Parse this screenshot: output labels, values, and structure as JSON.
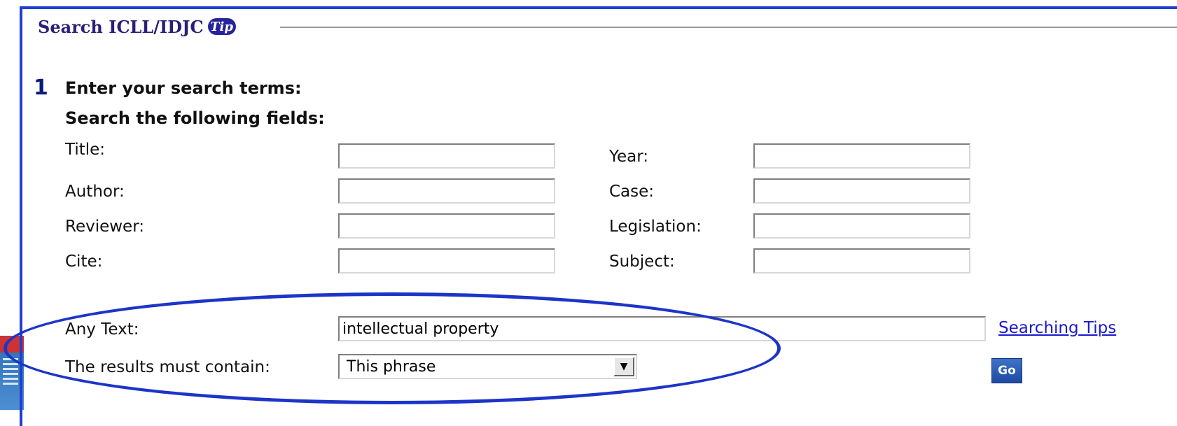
{
  "fieldset": {
    "legend": "Search ICLL/IDJC",
    "tip_icon_text": "Tip"
  },
  "step": {
    "number": "1",
    "heading": "Enter your search terms:",
    "subheading": "Search the following fields:"
  },
  "fields_left": [
    {
      "label": "Title:",
      "value": ""
    },
    {
      "label": "Author:",
      "value": ""
    },
    {
      "label": "Reviewer:",
      "value": ""
    },
    {
      "label": "Cite:",
      "value": ""
    }
  ],
  "fields_right": [
    {
      "label": "Year:",
      "value": ""
    },
    {
      "label": "Case:",
      "value": ""
    },
    {
      "label": "Legislation:",
      "value": ""
    },
    {
      "label": "Subject:",
      "value": ""
    }
  ],
  "any_text": {
    "label": "Any Text:",
    "value": "intellectual property"
  },
  "results": {
    "label": "The results must contain:",
    "selected": "This phrase"
  },
  "links": {
    "searching_tips": "Searching Tips"
  },
  "buttons": {
    "go": "Go"
  },
  "colors": {
    "frame": "#1f3fcf",
    "legend": "#2a1f78",
    "annotation_ellipse": "#1c35c8",
    "link": "#1a1acc"
  },
  "icons": {
    "tip": "tip-icon",
    "dropdown": "chevron-down-icon"
  }
}
